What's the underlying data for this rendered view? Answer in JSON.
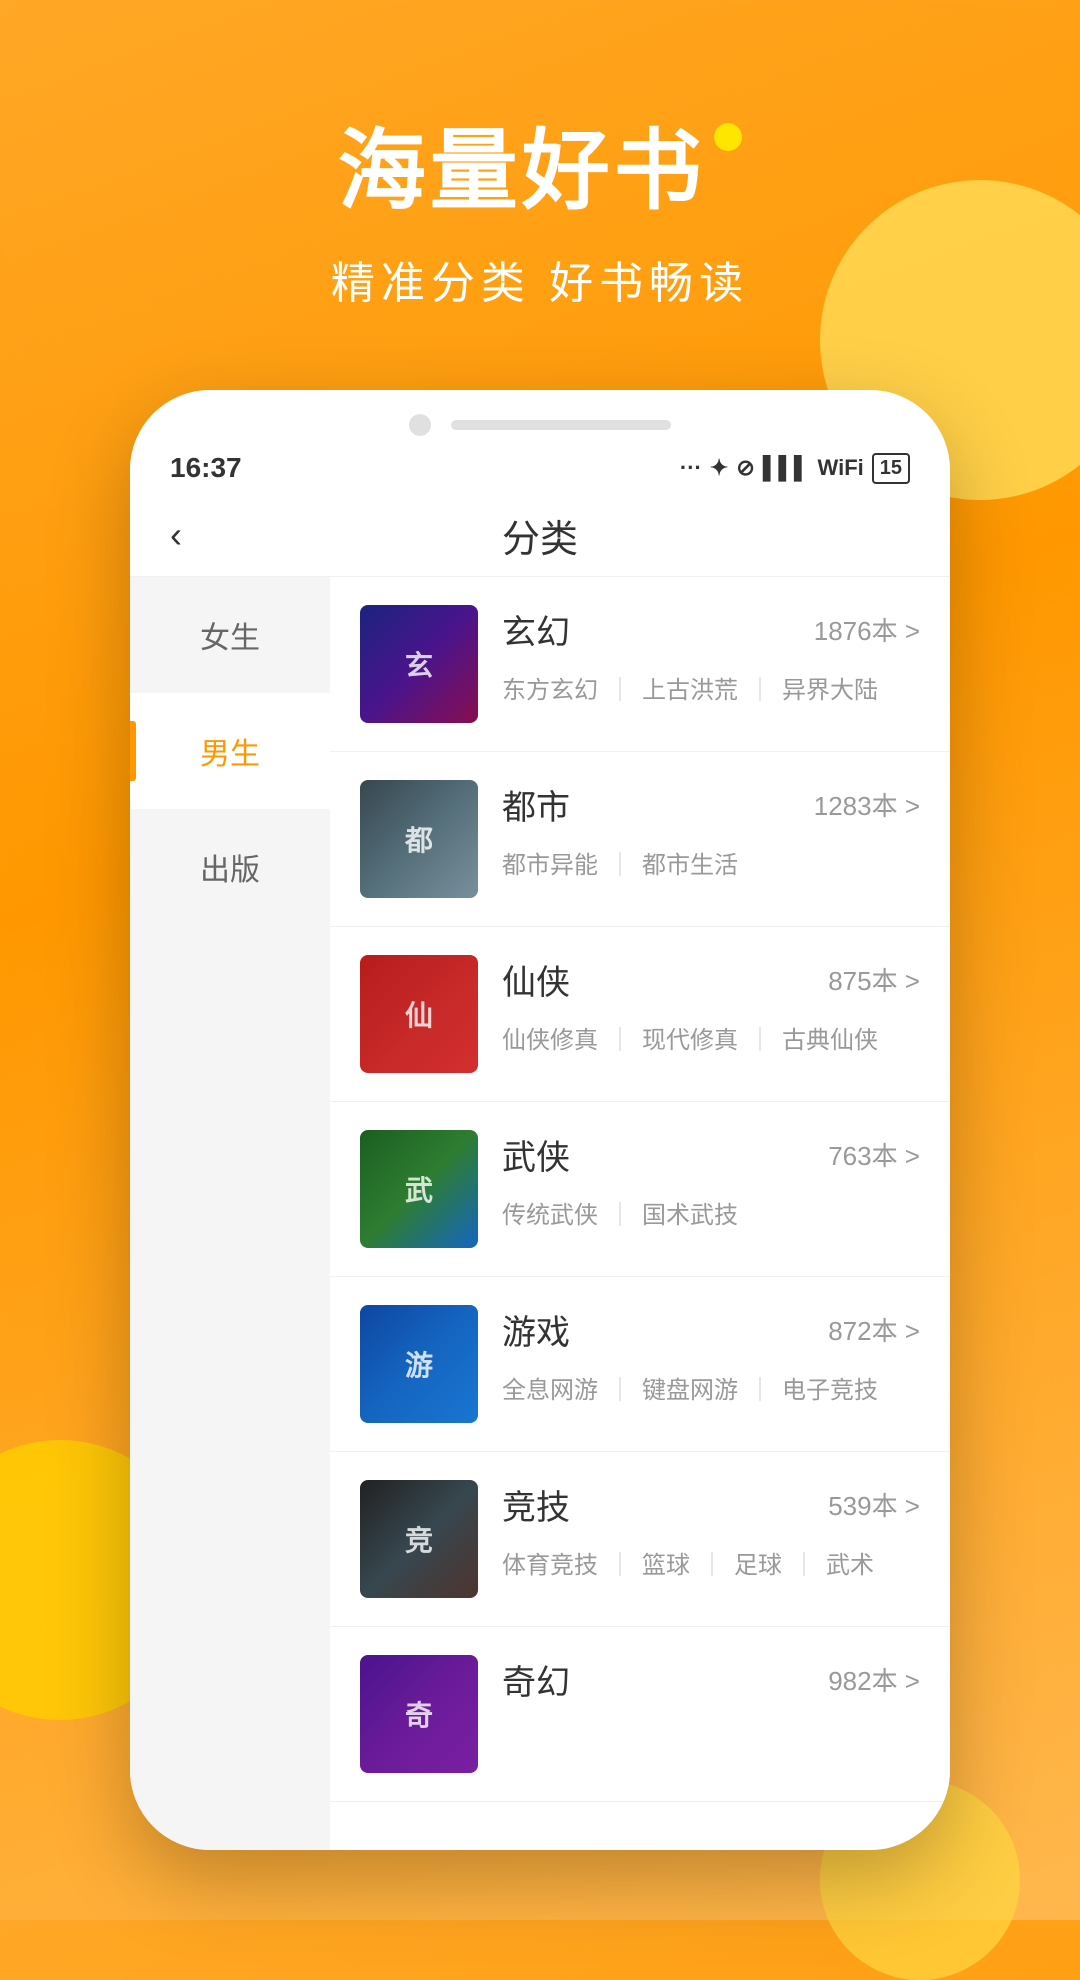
{
  "background": {
    "gradient_start": "#FFA726",
    "gradient_end": "#FF9800"
  },
  "hero": {
    "title": "海量好书",
    "subtitle": "精准分类 好书畅读"
  },
  "status_bar": {
    "time": "16:37",
    "battery": "15",
    "icons": "··· ✦ ⊘ ▌▌▌ ✦"
  },
  "nav": {
    "back_label": "‹",
    "title": "分类"
  },
  "sidebar": {
    "items": [
      {
        "id": "female",
        "label": "女生",
        "active": false
      },
      {
        "id": "male",
        "label": "男生",
        "active": true
      },
      {
        "id": "publish",
        "label": "出版",
        "active": false
      }
    ]
  },
  "books": [
    {
      "id": "xuanhuan",
      "title": "玄幻",
      "count": "1876本 >",
      "tags": [
        "东方玄幻",
        "上古洪荒",
        "异界大陆"
      ],
      "cover_class": "cover-xuanhuan",
      "cover_text": "玄"
    },
    {
      "id": "dushi",
      "title": "都市",
      "count": "1283本 >",
      "tags": [
        "都市异能",
        "都市生活"
      ],
      "cover_class": "cover-dushi",
      "cover_text": "都"
    },
    {
      "id": "xianxia",
      "title": "仙侠",
      "count": "875本 >",
      "tags": [
        "仙侠修真",
        "现代修真",
        "古典仙侠"
      ],
      "cover_class": "cover-xianxia",
      "cover_text": "仙"
    },
    {
      "id": "wuxia",
      "title": "武侠",
      "count": "763本 >",
      "tags": [
        "传统武侠",
        "国术武技"
      ],
      "cover_class": "cover-wuxia",
      "cover_text": "武"
    },
    {
      "id": "youxi",
      "title": "游戏",
      "count": "872本 >",
      "tags": [
        "全息网游",
        "键盘网游",
        "电子竞技"
      ],
      "cover_class": "cover-youxi",
      "cover_text": "游"
    },
    {
      "id": "jingji",
      "title": "竞技",
      "count": "539本 >",
      "tags": [
        "体育竞技",
        "篮球",
        "足球",
        "武术"
      ],
      "cover_class": "cover-jingji",
      "cover_text": "竞"
    },
    {
      "id": "qihuan",
      "title": "奇幻",
      "count": "982本 >",
      "tags": [],
      "cover_class": "cover-qihuan",
      "cover_text": "奇"
    }
  ]
}
